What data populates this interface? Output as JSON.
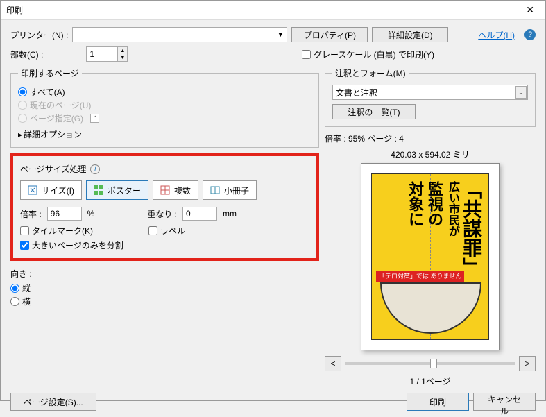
{
  "window": {
    "title": "印刷"
  },
  "header": {
    "printer_label": "プリンター(N) :",
    "properties_btn": "プロパティ(P)",
    "advanced_btn": "詳細設定(D)",
    "help_link": "ヘルプ(H)",
    "copies_label": "部数(C) :",
    "copies_value": "1",
    "grayscale_label": "グレースケール (白黒) で印刷(Y)"
  },
  "pages": {
    "legend": "印刷するページ",
    "all": "すべて(A)",
    "current": "現在のページ(U)",
    "range": "ページ指定(G)",
    "range_value": "1",
    "advanced": "詳細オプション"
  },
  "sizing": {
    "legend": "ページサイズ処理",
    "size_btn": "サイズ(I)",
    "poster_btn": "ポスター",
    "multiple_btn": "複数",
    "booklet_btn": "小冊子",
    "scale_label": "倍率 :",
    "scale_value": "96",
    "percent": "%",
    "overlap_label": "重なり :",
    "overlap_value": "0",
    "overlap_unit": "mm",
    "tile_marks": "タイルマーク(K)",
    "labels": "ラベル",
    "large_only": "大きいページのみを分割"
  },
  "orientation": {
    "legend": "向き :",
    "portrait": "縦",
    "landscape": "横"
  },
  "right": {
    "comments_legend": "注釈とフォーム(M)",
    "comments_value": "文書と注釈",
    "summary_btn": "注釈の一覧(T)",
    "scale_info": "倍率 : 95% ページ : 4",
    "dims": "420.03 x 594.02 ミリ",
    "page_nav": "1 / 1ページ",
    "poster": {
      "t1": "「共謀罪」",
      "t2": "広い市民が",
      "t3": "監視の",
      "t4": "対象に",
      "tag": "「テロ対策」では\nありません"
    }
  },
  "footer": {
    "page_setup": "ページ設定(S)...",
    "print": "印刷",
    "cancel": "キャンセル"
  }
}
